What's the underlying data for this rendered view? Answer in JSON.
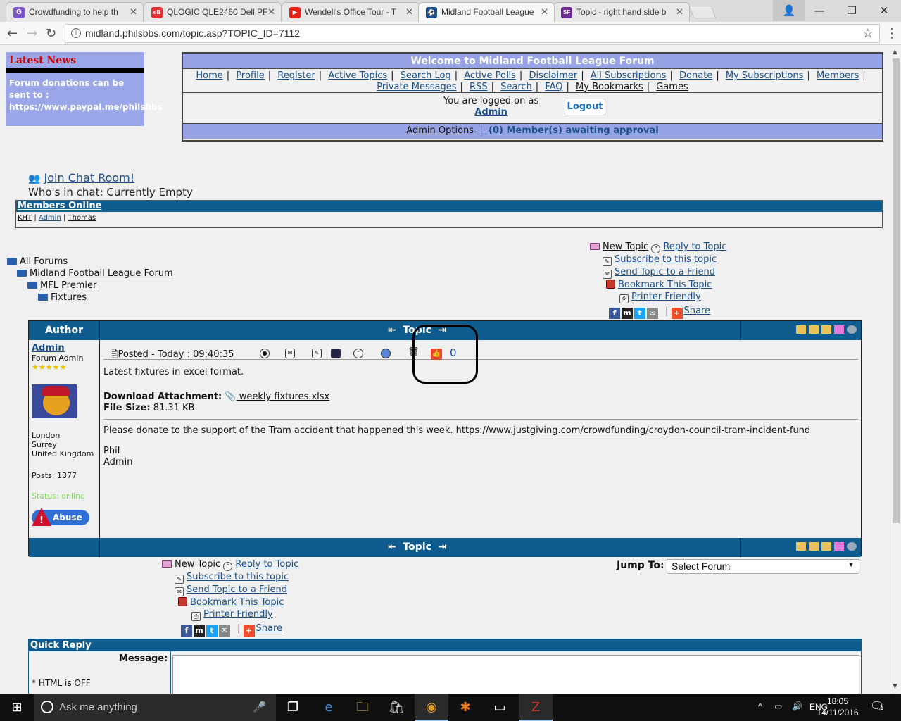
{
  "browser": {
    "tabs": [
      {
        "title": "Crowdfunding to help th",
        "icon": "G",
        "color": "#7b56c9"
      },
      {
        "title": "QLOGIC QLE2460 Dell PF",
        "icon": "eB",
        "color": "#e53238"
      },
      {
        "title": "Wendell's Office Tour - T",
        "icon": "▶",
        "color": "#e62117"
      },
      {
        "title": "Midland Football League",
        "icon": "⚽",
        "color": "#1a4f8a"
      },
      {
        "title": "Topic - right hand side b",
        "icon": "SF",
        "color": "#6b2b8f"
      }
    ],
    "url": "midland.philsbbs.com/topic.asp?TOPIC_ID=7112"
  },
  "news": {
    "heading": "Latest News",
    "body": "Forum donations can be sent to : https://www.paypal.me/philsbbs"
  },
  "welcome": {
    "title": "Welcome to Midland Football League Forum",
    "links_row1": [
      "Home",
      "Profile",
      "Register",
      "Active Topics",
      "Search Log",
      "Active Polls",
      "Disclaimer",
      "All Subscriptions",
      "Donate",
      "My Subscriptions",
      "Members"
    ],
    "links_row2": [
      "Private Messages",
      "RSS",
      "Search",
      "FAQ",
      "My Bookmarks",
      "Games"
    ],
    "logged_text": "You are logged on as",
    "logged_user": "Admin",
    "logout": "Logout",
    "admin_options": "Admin Options",
    "awaiting": "(0) Member(s) awaiting approval"
  },
  "chat": {
    "join": "Join Chat Room!",
    "who": "Who's in chat: Currently Empty"
  },
  "members": {
    "heading": "Members Online",
    "list": [
      "KHT",
      "Admin",
      "Thomas"
    ]
  },
  "breadcrumb": [
    "All Forums",
    "Midland Football League Forum",
    "MFL Premier",
    "Fixtures"
  ],
  "actions": {
    "new_topic": "New Topic",
    "reply": "Reply to Topic",
    "subscribe": "Subscribe to this topic",
    "send": "Send Topic to a Friend",
    "bookmark": "Bookmark This Topic",
    "printer": "Printer Friendly",
    "share": "Share"
  },
  "topic": {
    "author_header": "Author",
    "topic_header": "Topic",
    "author": {
      "name": "Admin",
      "role": "Forum Admin",
      "stars": "★★★★★",
      "city": "London",
      "county": "Surrey",
      "country": "United Kingdom",
      "posts": "Posts: 1377",
      "status": "Status: online",
      "abuse": "Abuse"
    },
    "post": {
      "posted": "Posted - Today :  09:40:35",
      "likes": "0",
      "body1": "Latest fixtures in excel format.",
      "download_label": "Download Attachment:",
      "attachment": " weekly fixtures.xlsx",
      "file_size_label": "File Size:",
      "file_size": "81.31 KB",
      "donate_text": "Please donate to the support of the Tram accident that happened this week.",
      "donate_link": "https://www.justgiving.com/crowdfunding/croydon-council-tram-incident-fund",
      "sig_name": "Phil",
      "sig_role": "Admin"
    }
  },
  "jump": {
    "label": "Jump To:",
    "selected": "Select Forum"
  },
  "quick_reply": {
    "heading": "Quick Reply",
    "message_label": "Message:",
    "html_note": "* HTML is OFF"
  },
  "taskbar": {
    "search_placeholder": "Ask me anything",
    "lang": "ENG",
    "time": "18:05",
    "date": "14/11/2016",
    "notifications": "1"
  }
}
